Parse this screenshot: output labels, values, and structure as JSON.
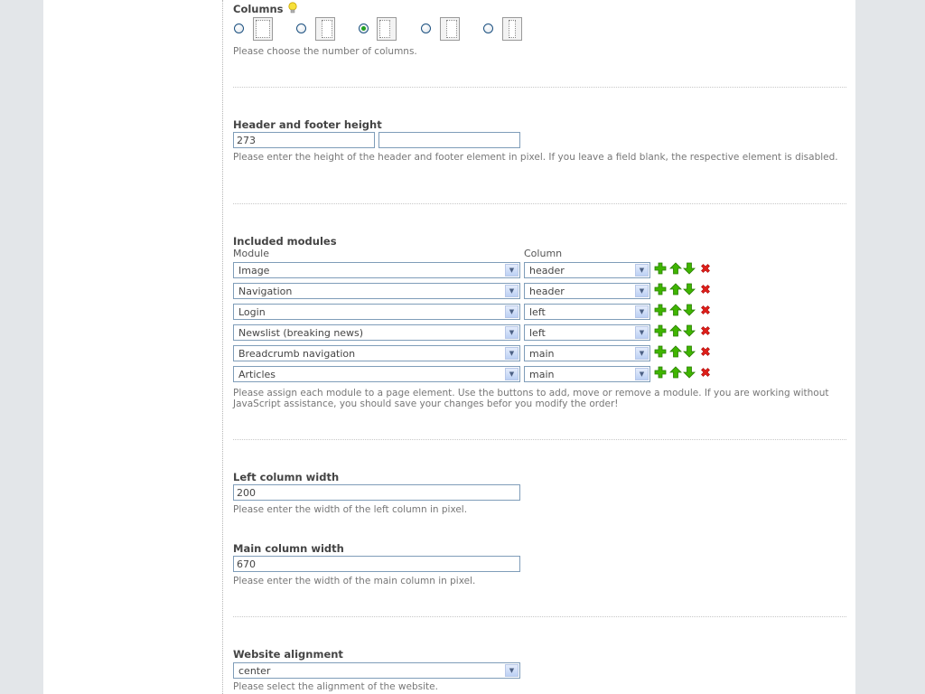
{
  "columns": {
    "label": "Columns",
    "help": "Please choose the number of columns.",
    "selected_index": 2
  },
  "header_footer": {
    "label": "Header and footer height",
    "header_value": "273",
    "footer_value": "",
    "help": "Please enter the height of the header and footer element in pixel. If you leave a field blank, the respective element is disabled."
  },
  "modules": {
    "label": "Included modules",
    "col_module": "Module",
    "col_column": "Column",
    "rows": [
      {
        "module": "Image",
        "column": "header"
      },
      {
        "module": "Navigation",
        "column": "header"
      },
      {
        "module": "Login",
        "column": "left"
      },
      {
        "module": "Newslist (breaking news)",
        "column": "left"
      },
      {
        "module": "Breadcrumb navigation",
        "column": "main"
      },
      {
        "module": "Articles",
        "column": "main"
      }
    ],
    "help": "Please assign each module to a page element. Use the buttons to add, move or remove a module. If you are working without JavaScript assistance, you should save your changes befor you modify the order!"
  },
  "left_width": {
    "label": "Left column width",
    "value": "200",
    "help": "Please enter the width of the left column in pixel."
  },
  "main_width": {
    "label": "Main column width",
    "value": "670",
    "help": "Please enter the width of the main column in pixel."
  },
  "alignment": {
    "label": "Website alignment",
    "value": "center",
    "help": "Please select the alignment of the website."
  },
  "icons": {
    "add": "plus-icon",
    "up": "arrow-up-icon",
    "down": "arrow-down-icon",
    "delete": "delete-icon",
    "hint": "lightbulb-icon"
  },
  "colors": {
    "page_bg": "#e3e6e9",
    "input_border": "#7f9db9",
    "add_green": "#3fb500",
    "delete_red": "#e0201a"
  }
}
